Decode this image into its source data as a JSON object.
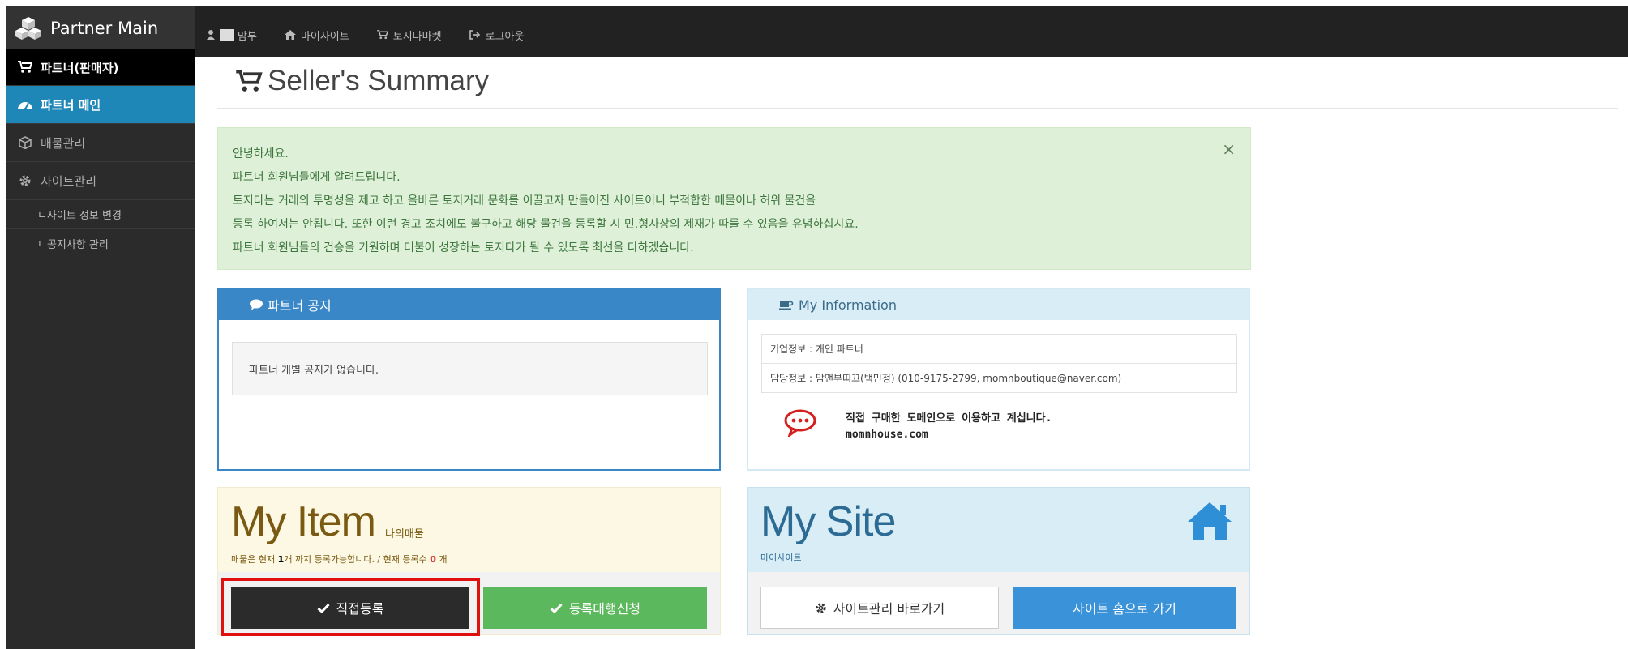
{
  "sidebar": {
    "brand": "Partner Main",
    "items": [
      {
        "label": "파트너(판매자)"
      },
      {
        "label": "파트너 메인"
      },
      {
        "label": "매물관리"
      },
      {
        "label": "사이트관리"
      }
    ],
    "subitems": [
      {
        "label": "ㄴ사이트 정보 변경"
      },
      {
        "label": "ㄴ공지사항 관리"
      }
    ]
  },
  "topbar": {
    "user_label": "맘부",
    "mysite_label": "마이사이트",
    "market_label": "토지다마켓",
    "logout_label": "로그아웃"
  },
  "page": {
    "title": "Seller's Summary"
  },
  "alert": {
    "lines": [
      "안녕하세요.",
      "파트너 회원님들에게 알려드립니다.",
      "토지다는 거래의 투명성을 제고 하고 올바른 토지거래 문화를 이끌고자 만들어진 사이트이니 부적합한 매물이나 허위 물건을",
      "등록 하여서는 안됩니다. 또한 이런 경고 조치에도 불구하고 해당 물건을 등록할 시 민.형사상의 제재가 따를 수 있음을 유념하십시요.",
      "파트너 회원님들의 건승을 기원하며 더불어 성장하는 토지다가 될 수 있도록 최선을 다하겠습니다."
    ],
    "close": "×"
  },
  "notice": {
    "title": "파트너 공지",
    "empty": "파트너 개별 공지가 없습니다."
  },
  "info": {
    "title": "My Information",
    "company": "기업정보 : 개인 파트너",
    "contact": "담당정보 : 맘앤부띠끄(백민정) (010-9175-2799, momnboutique@naver.com)",
    "msg_line1": "직접 구매한 도메인으로 이용하고 계십니다.",
    "msg_line2": "momnhouse.com"
  },
  "my_item": {
    "title": "My Item",
    "subtitle": "나의매물",
    "desc_prefix": "매물은 현재 ",
    "limit_count": "1",
    "desc_middle": "개 까지 등록가능합니다. / 현재 등록수 ",
    "current_count": "0",
    "desc_suffix": " 개",
    "btn_direct": "직접등록",
    "btn_proxy": "등록대행신청"
  },
  "my_site": {
    "title": "My Site",
    "subtitle": "마이사이트",
    "btn_manage": "사이트관리 바로가기",
    "btn_home": "사이트 홈으로 가기"
  },
  "colors": {
    "primary": "#3a87c8",
    "success": "#5cb85c",
    "highlight": "#e01010"
  }
}
